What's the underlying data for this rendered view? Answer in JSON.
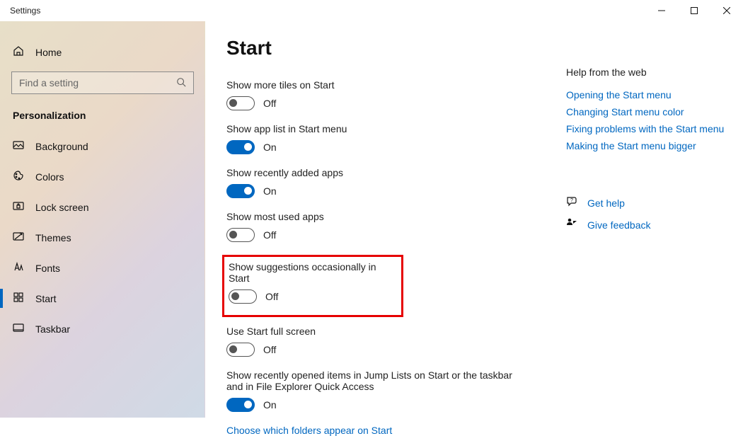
{
  "window": {
    "title": "Settings"
  },
  "sidebar": {
    "home": "Home",
    "search_placeholder": "Find a setting",
    "category": "Personalization",
    "items": [
      {
        "label": "Background"
      },
      {
        "label": "Colors"
      },
      {
        "label": "Lock screen"
      },
      {
        "label": "Themes"
      },
      {
        "label": "Fonts"
      },
      {
        "label": "Start"
      },
      {
        "label": "Taskbar"
      }
    ]
  },
  "page": {
    "title": "Start"
  },
  "state": {
    "on": "On",
    "off": "Off"
  },
  "settings": {
    "more_tiles": {
      "label": "Show more tiles on Start"
    },
    "app_list": {
      "label": "Show app list in Start menu"
    },
    "recent_apps": {
      "label": "Show recently added apps"
    },
    "most_used": {
      "label": "Show most used apps"
    },
    "suggestions": {
      "label": "Show suggestions occasionally in Start"
    },
    "full_screen": {
      "label": "Use Start full screen"
    },
    "jump_lists": {
      "label": "Show recently opened items in Jump Lists on Start or the taskbar and in File Explorer Quick Access"
    },
    "choose_folders": "Choose which folders appear on Start"
  },
  "help": {
    "header": "Help from the web",
    "links": [
      "Opening the Start menu",
      "Changing Start menu color",
      "Fixing problems with the Start menu",
      "Making the Start menu bigger"
    ],
    "get_help": "Get help",
    "feedback": "Give feedback"
  }
}
